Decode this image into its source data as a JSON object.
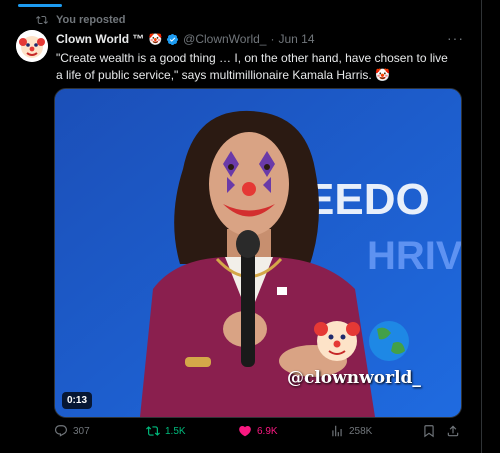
{
  "repost": {
    "label": "You reposted"
  },
  "tweet": {
    "display_name": "Clown World ™",
    "name_emoji": "🤡",
    "handle": "@ClownWorld_",
    "separator": "·",
    "date": "Jun 14",
    "more": "···",
    "text": "\"Create wealth is a good thing … I, on the other hand, have chosen to live a life of public service,\" says multimillionaire Kamala Harris. 🤡"
  },
  "media": {
    "duration": "0:13",
    "watermark": "@clownworld_",
    "backdrop_text_1": "EEDO",
    "backdrop_text_2": "HRIV"
  },
  "actions": {
    "replies": "307",
    "reposts": "1.5K",
    "likes": "6.9K",
    "views": "258K"
  },
  "colors": {
    "background": "#000000",
    "accent": "#1d9bf0",
    "repost_active": "#00ba7c",
    "like_active": "#f91880",
    "muted": "#71767b",
    "video_backdrop": "#1a5fd0",
    "jacket": "#8a1f4e"
  },
  "icons": [
    "repost-icon",
    "verified-badge-icon",
    "reply-icon",
    "like-icon",
    "views-icon",
    "bookmark-icon",
    "share-icon",
    "clown-emoji",
    "globe-emoji"
  ]
}
